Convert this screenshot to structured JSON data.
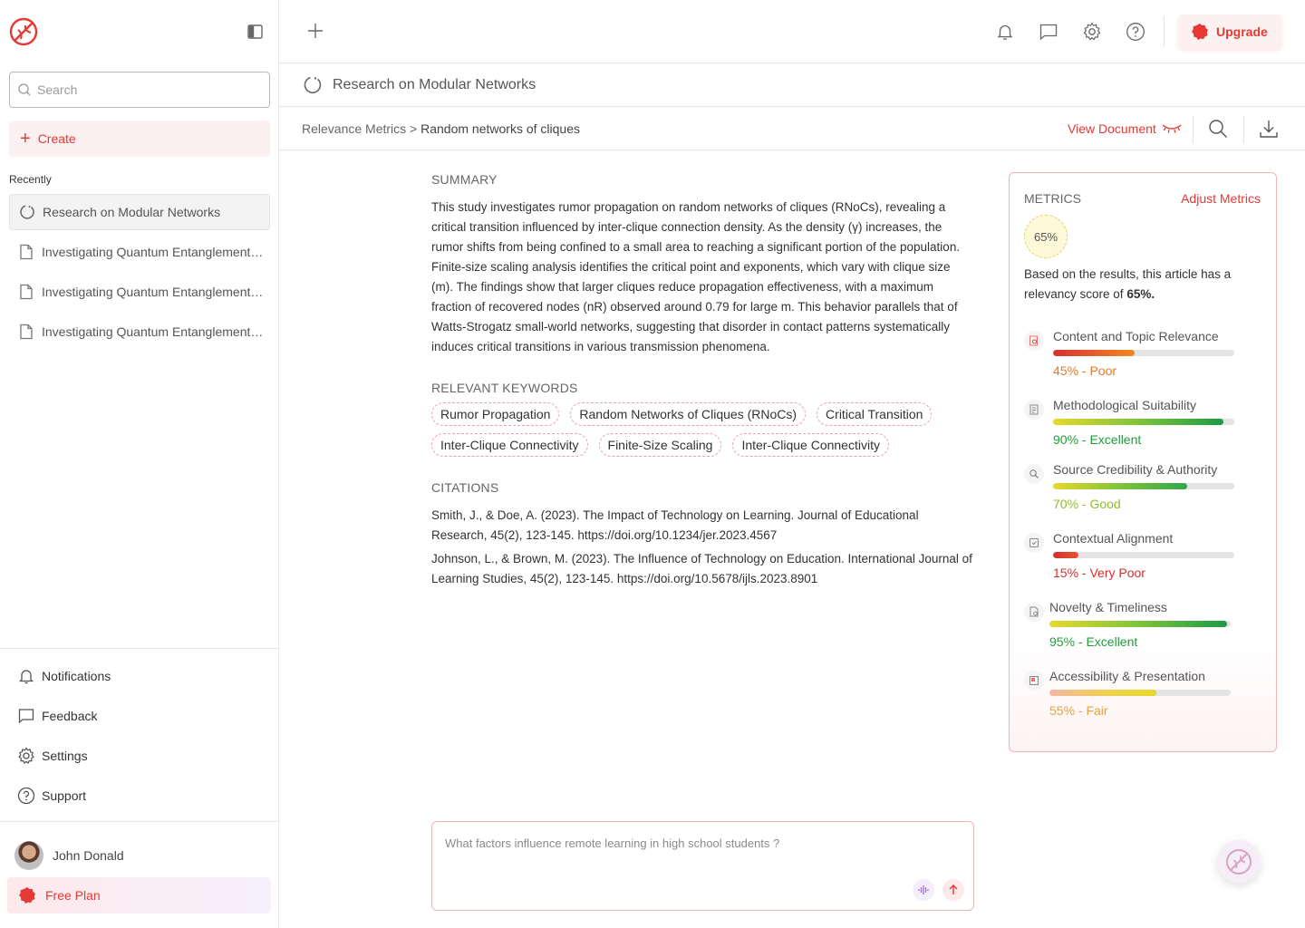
{
  "sidebar": {
    "search_placeholder": "Search",
    "create_label": "Create",
    "recently_label": "Recently",
    "recent_items": [
      {
        "label": "Research on Modular Networks"
      },
      {
        "label": "Investigating Quantum Entanglement: It.."
      },
      {
        "label": "Investigating Quantum Entanglement: It.."
      },
      {
        "label": "Investigating Quantum Entanglement: It.."
      }
    ],
    "links": {
      "notifications": "Notifications",
      "feedback": "Feedback",
      "settings": "Settings",
      "support": "Support"
    },
    "user_name": "John Donald",
    "plan_label": "Free Plan"
  },
  "header": {
    "upgrade_label": "Upgrade",
    "icons": [
      "plus-icon",
      "bell-icon",
      "chat-icon",
      "gear-icon",
      "help-icon"
    ]
  },
  "document": {
    "title": "Research on Modular Networks",
    "breadcrumb_parent": "Relevance Metrics",
    "breadcrumb_sep": ">",
    "breadcrumb_current": "Random networks of cliques",
    "view_document_label": "View Document"
  },
  "summary": {
    "title": "SUMMARY",
    "text": "This study investigates rumor propagation on random networks of cliques (RNoCs), revealing a critical transition influenced by inter-clique connection density. As the density (γ) increases, the rumor shifts from being confined to a small area to reaching a significant portion of the population. Finite-size scaling analysis identifies the critical point and exponents, which vary with clique size (m). The findings show that larger cliques reduce propagation effectiveness, with a maximum fraction of recovered nodes (nR) observed around 0.79 for large m. This behavior parallels that of Watts-Strogatz small-world networks, suggesting that disorder in contact patterns systematically induces critical transitions in various transmission phenomena."
  },
  "keywords": {
    "title": "RELEVANT KEYWORDS",
    "items": [
      "Rumor Propagation",
      "Random Networks of Cliques (RNoCs)",
      "Critical Transition",
      "Inter-Clique Connectivity",
      "Finite-Size Scaling",
      "Inter-Clique Connectivity"
    ]
  },
  "citations": {
    "title": "CITATIONS",
    "items": [
      "Smith, J., & Doe, A. (2023). The Impact of Technology on Learning. Journal of Educational Research, 45(2), 123-145. https://doi.org/10.1234/jer.2023.4567",
      "Johnson, L., & Brown, M. (2023). The Influence of Technology on Education. International Journal of Learning Studies, 45(2), 123-145. https://doi.org/10.5678/ijls.2023.8901"
    ]
  },
  "metrics": {
    "title": "METRICS",
    "adjust_label": "Adjust Metrics",
    "score": "65%",
    "desc_prefix": "Based on the results, this article has a relevancy score of ",
    "desc_score": "65%.",
    "items": [
      {
        "label": "Content and Topic Relevance",
        "value": "45% - Poor",
        "percent": 45,
        "color": "#e8792b",
        "gradient": "linear-gradient(90deg,#d62f2f,#f08a24)"
      },
      {
        "label": "Methodological Suitability",
        "value": "90% - Excellent",
        "percent": 94,
        "color": "#1e9e3a",
        "gradient": "linear-gradient(90deg,#e6d92c,#7ec43a,#1b9a45)"
      },
      {
        "label": "Source Credibility & Authority",
        "value": "70% - Good",
        "percent": 74,
        "color": "#8cbf26",
        "gradient": "linear-gradient(90deg,#e6d92c,#7ec43a,#2fa84a)"
      },
      {
        "label": "Contextual Alignment",
        "value": "15% - Very Poor",
        "percent": 14,
        "color": "#d62f2f",
        "gradient": "linear-gradient(90deg,#d62f2f,#e6532c)"
      },
      {
        "label": "Novelty & Timeliness",
        "value": "95% - Excellent",
        "percent": 98,
        "color": "#1e9e3a",
        "gradient": "linear-gradient(90deg,#e6d92c,#7ec43a,#1b9a45)"
      },
      {
        "label": "Accessibility & Presentation",
        "value": "55% - Fair",
        "percent": 59,
        "color": "#eaa33c",
        "gradient": "linear-gradient(90deg,#f3b6a2,#f0cf54,#e6d92c)"
      }
    ]
  },
  "prompt": {
    "placeholder": "What factors influence remote learning in high school students ?"
  }
}
